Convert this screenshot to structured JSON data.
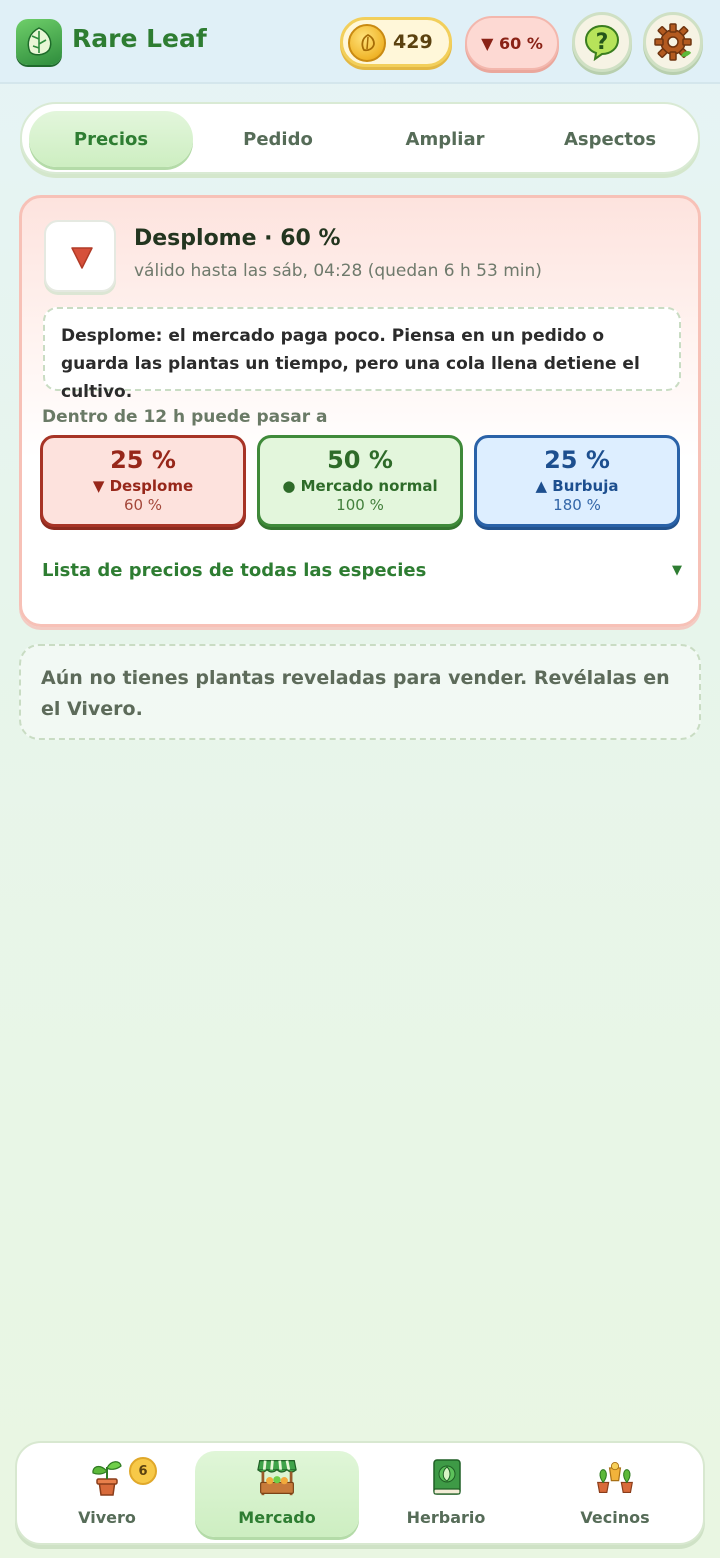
{
  "header": {
    "app_title": "Rare Leaf",
    "coins": "429",
    "market_pill": "▼ 60 %",
    "icons": [
      "leaf-logo-icon",
      "coin-icon",
      "help-icon",
      "gear-icon"
    ]
  },
  "tabs": [
    {
      "label": "Precios",
      "active": true
    },
    {
      "label": "Pedido",
      "active": false
    },
    {
      "label": "Ampliar",
      "active": false
    },
    {
      "label": "Aspectos",
      "active": false
    }
  ],
  "market": {
    "title": "Desplome · 60 %",
    "subtitle": "válido hasta las sáb, 04:28 (quedan 6 h 53 min)",
    "description": "Desplome: el mercado paga poco. Piensa en un pedido o guarda las plantas un tiempo, pero una cola llena detiene el cultivo.",
    "forecast_label": "Dentro de 12 h puede pasar a",
    "forecast": [
      {
        "pct": "25 %",
        "name": "▼ Desplome",
        "mult": "60 %"
      },
      {
        "pct": "50 %",
        "name": "● Mercado normal",
        "mult": "100 %"
      },
      {
        "pct": "25 %",
        "name": "▲ Burbuja",
        "mult": "180 %"
      }
    ],
    "price_list_label": "Lista de precios de todas las especies",
    "chevron": "▼",
    "colors": {
      "crash": "#a73426",
      "normal": "#3f8a3a",
      "bubble": "#2a62a8"
    }
  },
  "empty_notice": "Aún no tienes plantas reveladas para vender. Revélalas en el Vivero.",
  "nav": [
    {
      "label": "Vivero",
      "icon": "potted-plant-icon",
      "badge": "6",
      "active": false
    },
    {
      "label": "Mercado",
      "icon": "market-stall-icon",
      "active": true
    },
    {
      "label": "Herbario",
      "icon": "book-icon",
      "active": false
    },
    {
      "label": "Vecinos",
      "icon": "neighbors-plants-icon",
      "active": false
    }
  ]
}
